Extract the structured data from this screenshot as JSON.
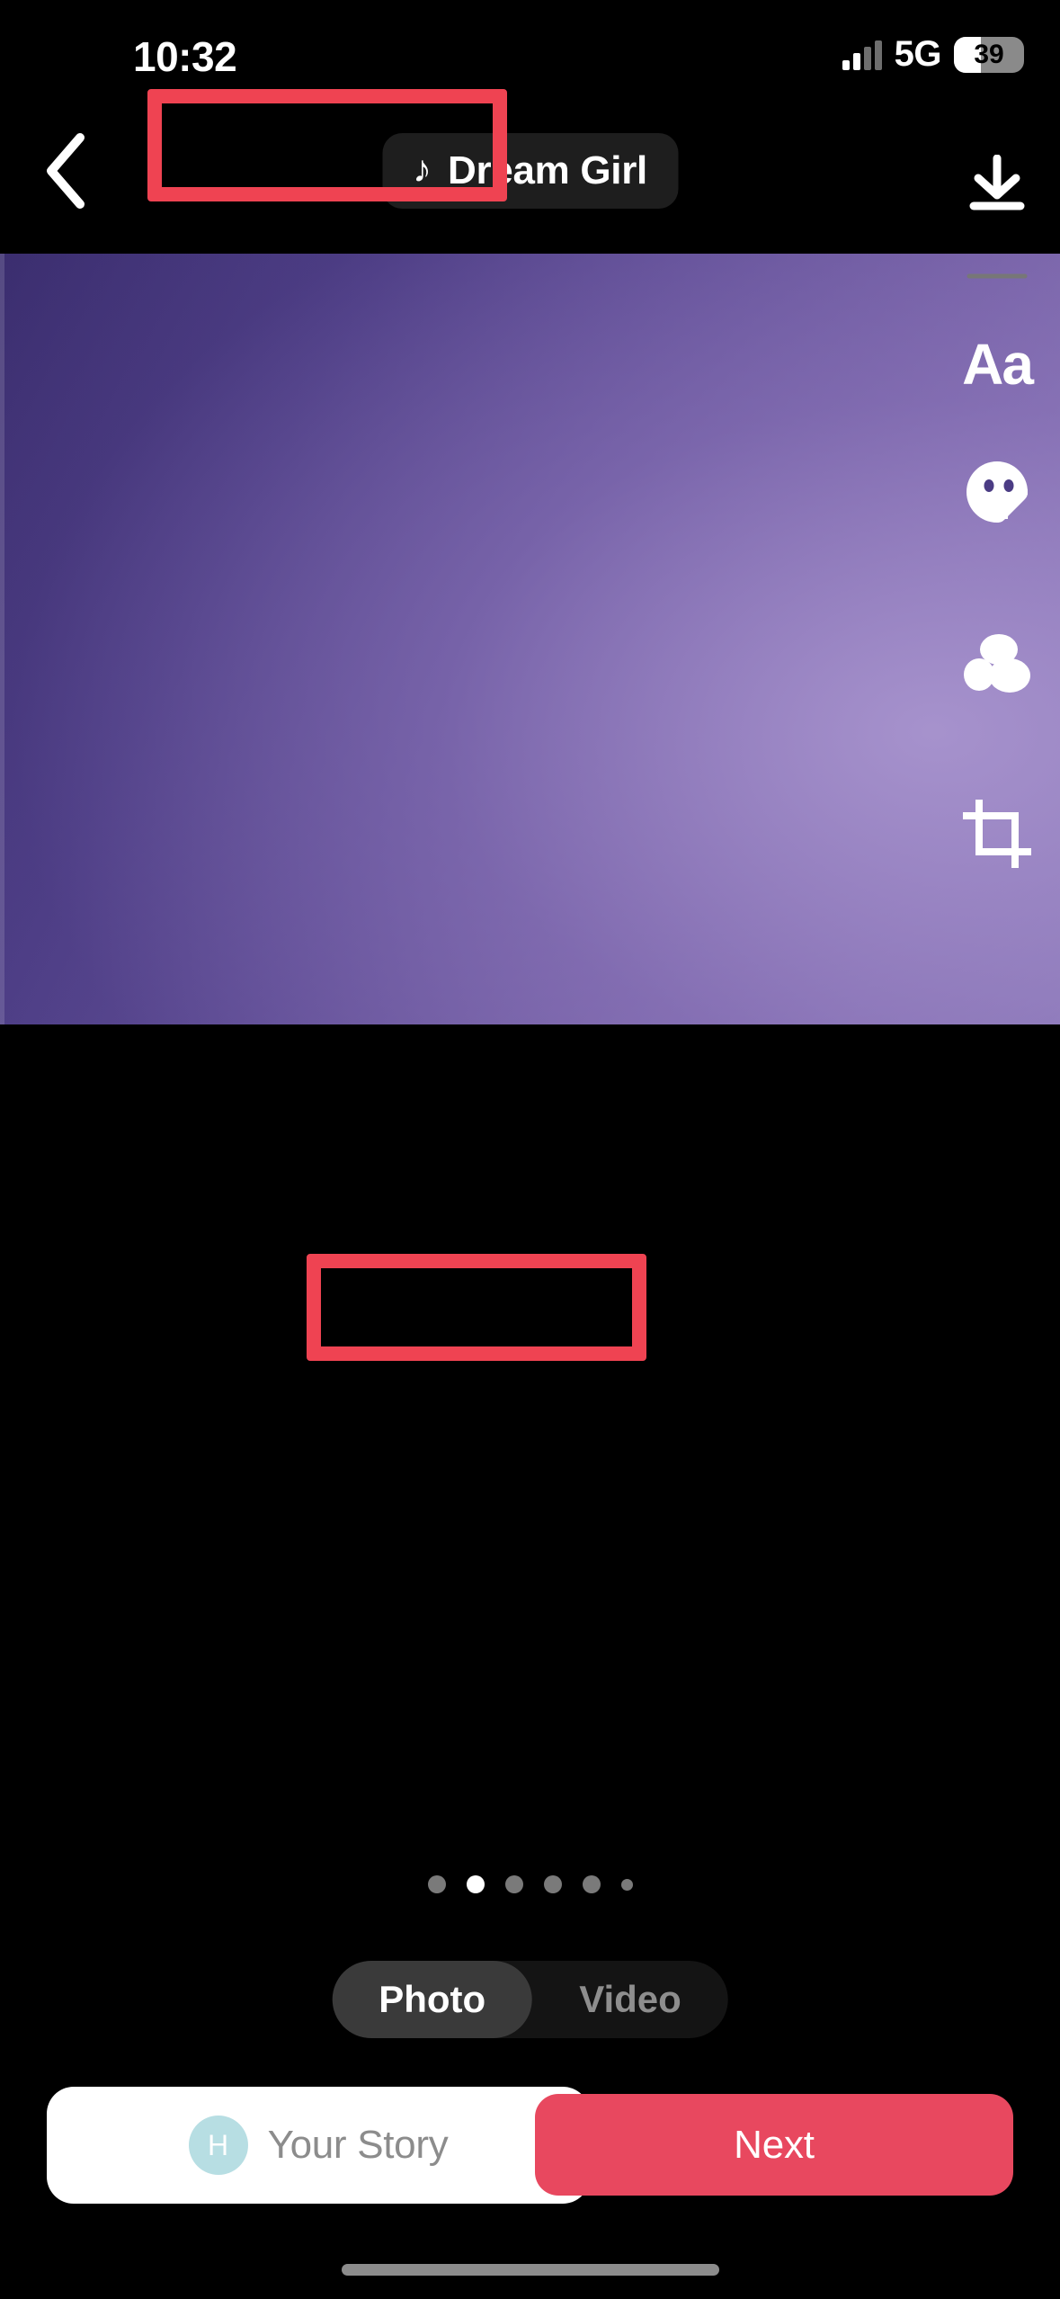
{
  "status_bar": {
    "time": "10:32",
    "network": "5G",
    "battery_level": "39",
    "battery_percent": 39,
    "signal_icon": "cellular-signal-icon",
    "battery_icon": "battery-icon"
  },
  "top_bar": {
    "back_icon": "chevron-left-icon",
    "music_note_icon": "music-note-icon",
    "music_title": "Dream Girl"
  },
  "right_toolbar": {
    "items": [
      {
        "name": "download-icon",
        "label": "Save"
      },
      {
        "name": "text-tool",
        "label": "Aa"
      },
      {
        "name": "sticker-icon",
        "label": "Stickers"
      },
      {
        "name": "effects-icon",
        "label": "Effects"
      },
      {
        "name": "crop-icon",
        "label": "Crop"
      }
    ],
    "text_tool_label": "Aa"
  },
  "media": {
    "type": "gradient-image",
    "colors": {
      "dark": "#3a2d6e",
      "mid": "#5f4d96",
      "light": "#9482bf"
    }
  },
  "carousel": {
    "total_dots": 6,
    "active_index": 1
  },
  "mode_toggle": {
    "options": [
      {
        "label": "Photo",
        "active": true
      },
      {
        "label": "Video",
        "active": false
      }
    ]
  },
  "bottom_bar": {
    "your_story": {
      "label": "Your Story",
      "avatar_initial": "H",
      "avatar_color": "#b7dee3"
    },
    "next": {
      "label": "Next",
      "color": "#e8485f"
    }
  },
  "annotations": {
    "color": "#ef4352",
    "boxes": [
      {
        "target": "music-pill"
      },
      {
        "target": "next-button"
      }
    ]
  }
}
